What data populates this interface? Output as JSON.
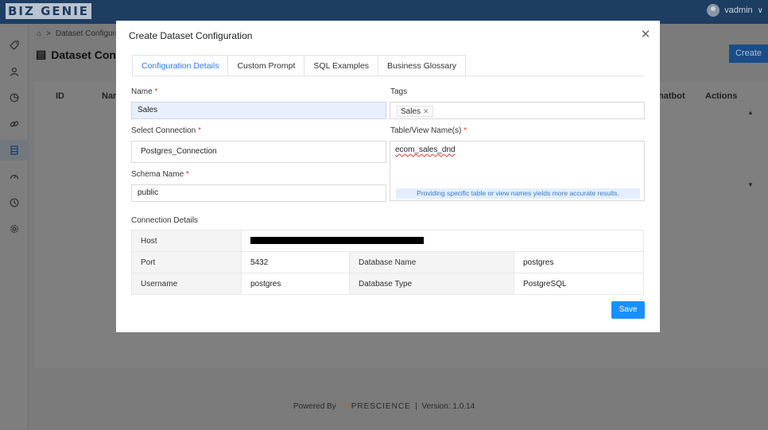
{
  "app": {
    "logo": "BIZ GENIE",
    "user": "vadmin"
  },
  "breadcrumb": {
    "current": "Dataset Configura"
  },
  "page": {
    "title": "Dataset Conf",
    "create_label": "Create"
  },
  "table_bg": {
    "columns": [
      "ID",
      "Nan",
      "hatbot",
      "Actions"
    ]
  },
  "footer": {
    "powered_by": "Powered By",
    "brand": "PRESCIENCE",
    "separator": "|",
    "version": "Version: 1.0.14"
  },
  "sidebar": {
    "items": [
      "tag-icon",
      "user-icon",
      "chart-icon",
      "link-icon",
      "dataset-icon",
      "dashboard-icon",
      "history-icon",
      "gear-icon"
    ]
  },
  "modal": {
    "title": "Create Dataset Configuration",
    "tabs": [
      {
        "label": "Configuration Details",
        "active": true
      },
      {
        "label": "Custom Prompt",
        "active": false
      },
      {
        "label": "SQL Examples",
        "active": false
      },
      {
        "label": "Business Glossary",
        "active": false
      }
    ],
    "name": {
      "label": "Name",
      "value": "Sales"
    },
    "tags": {
      "label": "Tags",
      "chip": "Sales"
    },
    "connection": {
      "label": "Select Connection",
      "value": "Postgres_Connection"
    },
    "tables": {
      "label": "Table/View Name(s)",
      "value": "ecom_sales_dnd",
      "hint": "Providing specific table or view names yields more accurate results."
    },
    "schema": {
      "label": "Schema Name",
      "value": "public"
    },
    "connection_details": {
      "label": "Connection Details",
      "host_label": "Host",
      "port_label": "Port",
      "port": "5432",
      "dbname_label": "Database Name",
      "dbname": "postgres",
      "username_label": "Username",
      "username": "postgres",
      "dbtype_label": "Database Type",
      "dbtype": "PostgreSQL"
    },
    "save_label": "Save"
  },
  "colors": {
    "primary": "#1890ff",
    "header": "#1d3d63",
    "required": "#e53935"
  }
}
